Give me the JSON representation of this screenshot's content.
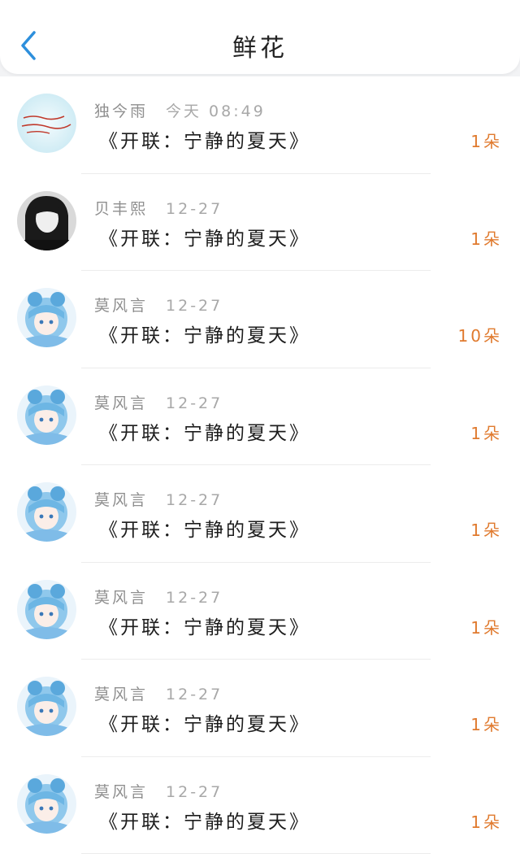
{
  "header": {
    "title": "鲜花",
    "back_icon": "chevron-left-icon",
    "accent_color": "#2d8fdc"
  },
  "count_color": "#e07a2e",
  "items": [
    {
      "user": "独今雨",
      "time": "今天 08:49",
      "title": "《开联：宁静的夏天》",
      "count": "1朵",
      "avatar": "avatar-a"
    },
    {
      "user": "贝丰熙",
      "time": "12-27",
      "title": "《开联：宁静的夏天》",
      "count": "1朵",
      "avatar": "avatar-b"
    },
    {
      "user": "莫风言",
      "time": "12-27",
      "title": "《开联：宁静的夏天》",
      "count": "10朵",
      "avatar": "avatar-c"
    },
    {
      "user": "莫风言",
      "time": "12-27",
      "title": "《开联：宁静的夏天》",
      "count": "1朵",
      "avatar": "avatar-c"
    },
    {
      "user": "莫风言",
      "time": "12-27",
      "title": "《开联：宁静的夏天》",
      "count": "1朵",
      "avatar": "avatar-c"
    },
    {
      "user": "莫风言",
      "time": "12-27",
      "title": "《开联：宁静的夏天》",
      "count": "1朵",
      "avatar": "avatar-c"
    },
    {
      "user": "莫风言",
      "time": "12-27",
      "title": "《开联：宁静的夏天》",
      "count": "1朵",
      "avatar": "avatar-c"
    },
    {
      "user": "莫风言",
      "time": "12-27",
      "title": "《开联：宁静的夏天》",
      "count": "1朵",
      "avatar": "avatar-c"
    }
  ]
}
